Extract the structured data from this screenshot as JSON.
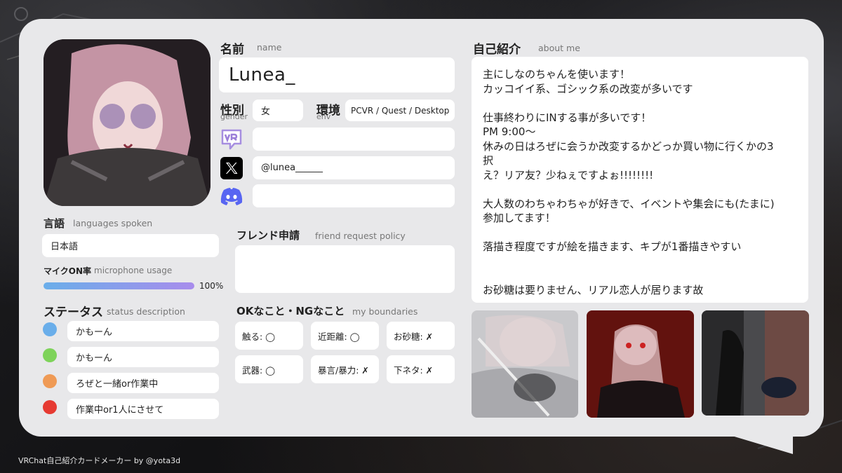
{
  "name_section": {
    "label_jp": "名前",
    "label_en": "name",
    "value": "Lunea_"
  },
  "gender": {
    "label_jp": "性別",
    "label_en": "gender",
    "value": "女"
  },
  "env": {
    "label_jp": "環境",
    "label_en": "env",
    "value": "PCVR / Quest / Desktop"
  },
  "social": {
    "vrchat": {
      "icon": "vrchat-icon",
      "value": ""
    },
    "x": {
      "icon": "x-logo-icon",
      "value": "@lunea______"
    },
    "discord": {
      "icon": "discord-icon",
      "value": ""
    }
  },
  "languages": {
    "label_jp": "言語",
    "label_en": "languages spoken",
    "value": "日本語"
  },
  "mic": {
    "label_jp": "マイクON率",
    "label_en": "microphone usage",
    "percent": 100,
    "percent_text": "100%"
  },
  "status": {
    "label_jp": "ステータス",
    "label_en": "status description",
    "items": [
      {
        "color": "#6aaeea",
        "text": "かもーん"
      },
      {
        "color": "#7ed35a",
        "text": "かもーん"
      },
      {
        "color": "#ef9a55",
        "text": "ろぜと一緒or作業中"
      },
      {
        "color": "#e63a32",
        "text": "作業中or1人にさせて"
      }
    ]
  },
  "friend_request": {
    "label_jp": "フレンド申請",
    "label_en": "friend request policy",
    "value": ""
  },
  "boundaries": {
    "label_jp": "OKなこと・NGなこと",
    "label_en": "my boundaries",
    "items": [
      "触る: ◯",
      "近距離: ◯",
      "お砂糖: ✗",
      "武器: ◯",
      "暴言/暴力: ✗",
      "下ネタ: ✗"
    ]
  },
  "about": {
    "label_jp": "自己紹介",
    "label_en": "about me",
    "text": "主にしなのちゃんを使います！\nカッコイイ系、ゴシック系の改変が多いです\n\n仕事終わりにINする事が多いです！\nPM 9:00〜\n休みの日はろぜに会うか改変するかどっか買い物に行くかの3\n択\nえ？リア友？少ねぇですよぉ!!!!!!!!\n\n大人数のわちゃわちゃが好きで、イベントや集会にも(たまに)\n参加してます！\n\n落描き程度ですが絵を描きます、キプが1番描きやすい\n\n\nお砂糖は要りません、リアル恋人が居ります故"
  },
  "footer": {
    "credit": "VRChat自己紹介カードメーカー by @yota3d"
  }
}
